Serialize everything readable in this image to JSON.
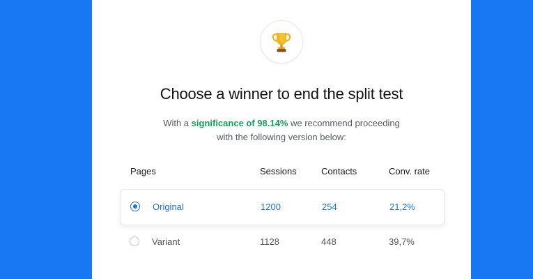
{
  "dialog": {
    "title": "Choose a winner to end the split test",
    "subtitle_prefix": "With a ",
    "subtitle_highlight": "significance of 98.14%",
    "subtitle_suffix": " we recommend proceeding with the following version below:",
    "icon": "trophy-icon"
  },
  "table": {
    "headers": [
      "Pages",
      "Sessions",
      "Contacts",
      "Conv. rate"
    ],
    "rows": [
      {
        "page": "Original",
        "sessions": "1200",
        "contacts": "254",
        "conv_rate": "21,2%",
        "selected": true
      },
      {
        "page": "Variant",
        "sessions": "1128",
        "contacts": "448",
        "conv_rate": "39,7%",
        "selected": false
      }
    ]
  },
  "colors": {
    "background": "#1878f3",
    "accent": "#1a74d2",
    "highlight": "#15a05a"
  }
}
